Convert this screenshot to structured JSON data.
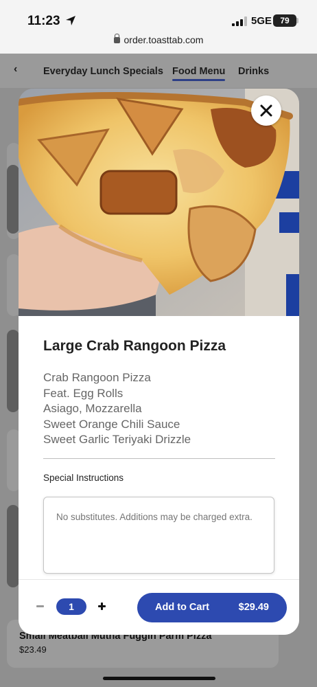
{
  "status_bar": {
    "time": "11:23",
    "network": "5GE",
    "battery": "79",
    "url": "order.toasttab.com"
  },
  "category_nav": {
    "back": "‹",
    "tabs": [
      {
        "label": "Everyday Lunch Specials",
        "active": false
      },
      {
        "label": "Food Menu",
        "active": true
      },
      {
        "label": "Drinks",
        "active": false
      }
    ]
  },
  "background_item": {
    "name": "Small Meatball Mutha Fuggin Parm Pizza",
    "price": "$23.49"
  },
  "modal": {
    "item_name": "Large Crab Rangoon Pizza",
    "description_lines": [
      "Crab Rangoon Pizza",
      "Feat. Egg Rolls",
      "Asiago, Mozzarella",
      "Sweet Orange Chili Sauce",
      "Sweet Garlic Teriyaki Drizzle"
    ],
    "special_instructions_label": "Special Instructions",
    "special_instructions_placeholder": "No substitutes. Additions may be charged extra.",
    "quantity": "1",
    "add_to_cart_label": "Add to Cart",
    "price": "$29.49"
  },
  "colors": {
    "accent": "#2d4ab0",
    "nav_underline": "#2d3f86"
  },
  "icons": {
    "close": "close-icon",
    "location": "location-arrow-icon",
    "lock": "lock-icon",
    "minus": "minus-icon",
    "plus": "plus-icon"
  }
}
